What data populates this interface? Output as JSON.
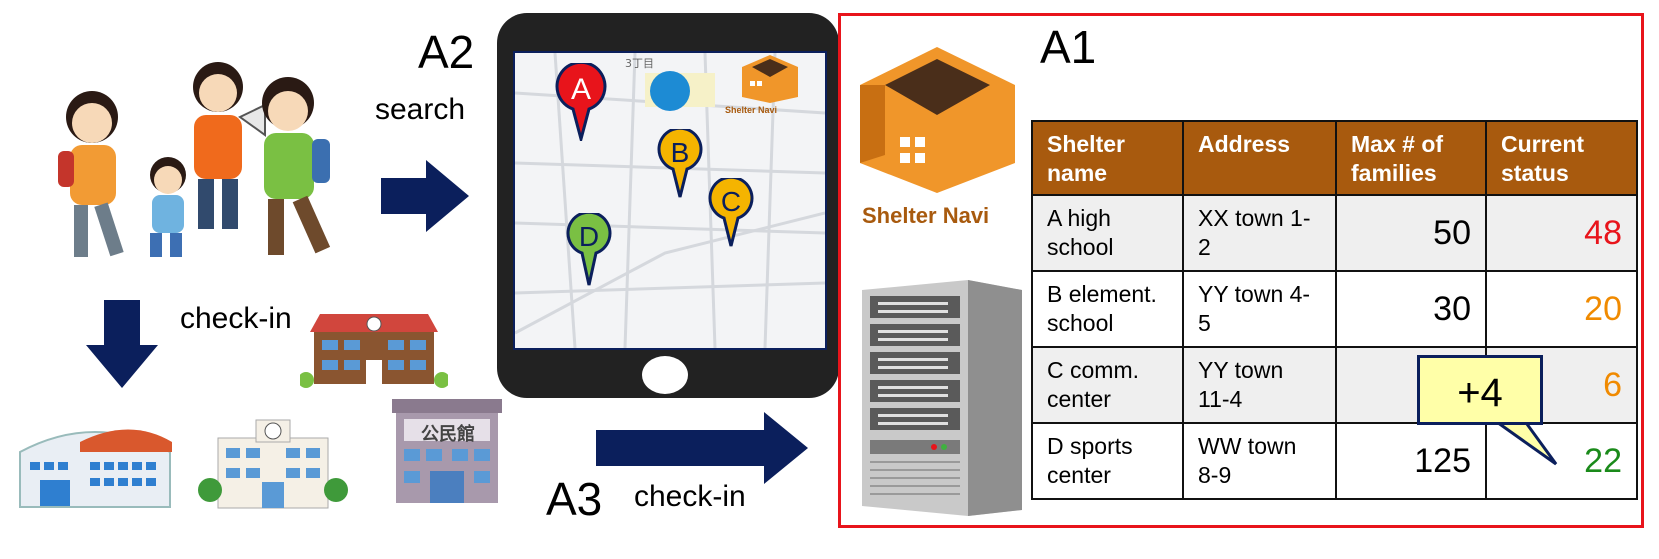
{
  "labels": {
    "a1": "A1",
    "a2": "A2",
    "a3": "A3",
    "search": "search",
    "checkin_left": "check-in",
    "checkin_bottom": "check-in"
  },
  "map": {
    "street_label": "3丁目",
    "pins": [
      {
        "letter": "A",
        "color": "#e8141b"
      },
      {
        "letter": "B",
        "color": "#f5b400"
      },
      {
        "letter": "C",
        "color": "#f5b400"
      },
      {
        "letter": "D",
        "color": "#7ac043"
      }
    ]
  },
  "brand": {
    "name_small": "Shelter Navi",
    "name_large": "Shelter Navi",
    "color": "#a85a0e"
  },
  "table": {
    "headers": [
      "Shelter name",
      "Address",
      "Max # of families",
      "Current status"
    ],
    "rows": [
      {
        "name": "A high school",
        "address": "XX town 1-2",
        "max": "50",
        "current": "48",
        "color": "#e8141b"
      },
      {
        "name": "B element. school",
        "address": "YY town 4-5",
        "max": "30",
        "current": "20",
        "color": "#f08a00"
      },
      {
        "name": "C comm. center",
        "address": "YY town 11-4",
        "max": "",
        "current": "6",
        "color": "#f08a00"
      },
      {
        "name": "D sports center",
        "address": "WW town 8-9",
        "max": "125",
        "current": "22",
        "color": "#1a8a1a"
      }
    ]
  },
  "callout": "+4",
  "building_sign": "公民館"
}
